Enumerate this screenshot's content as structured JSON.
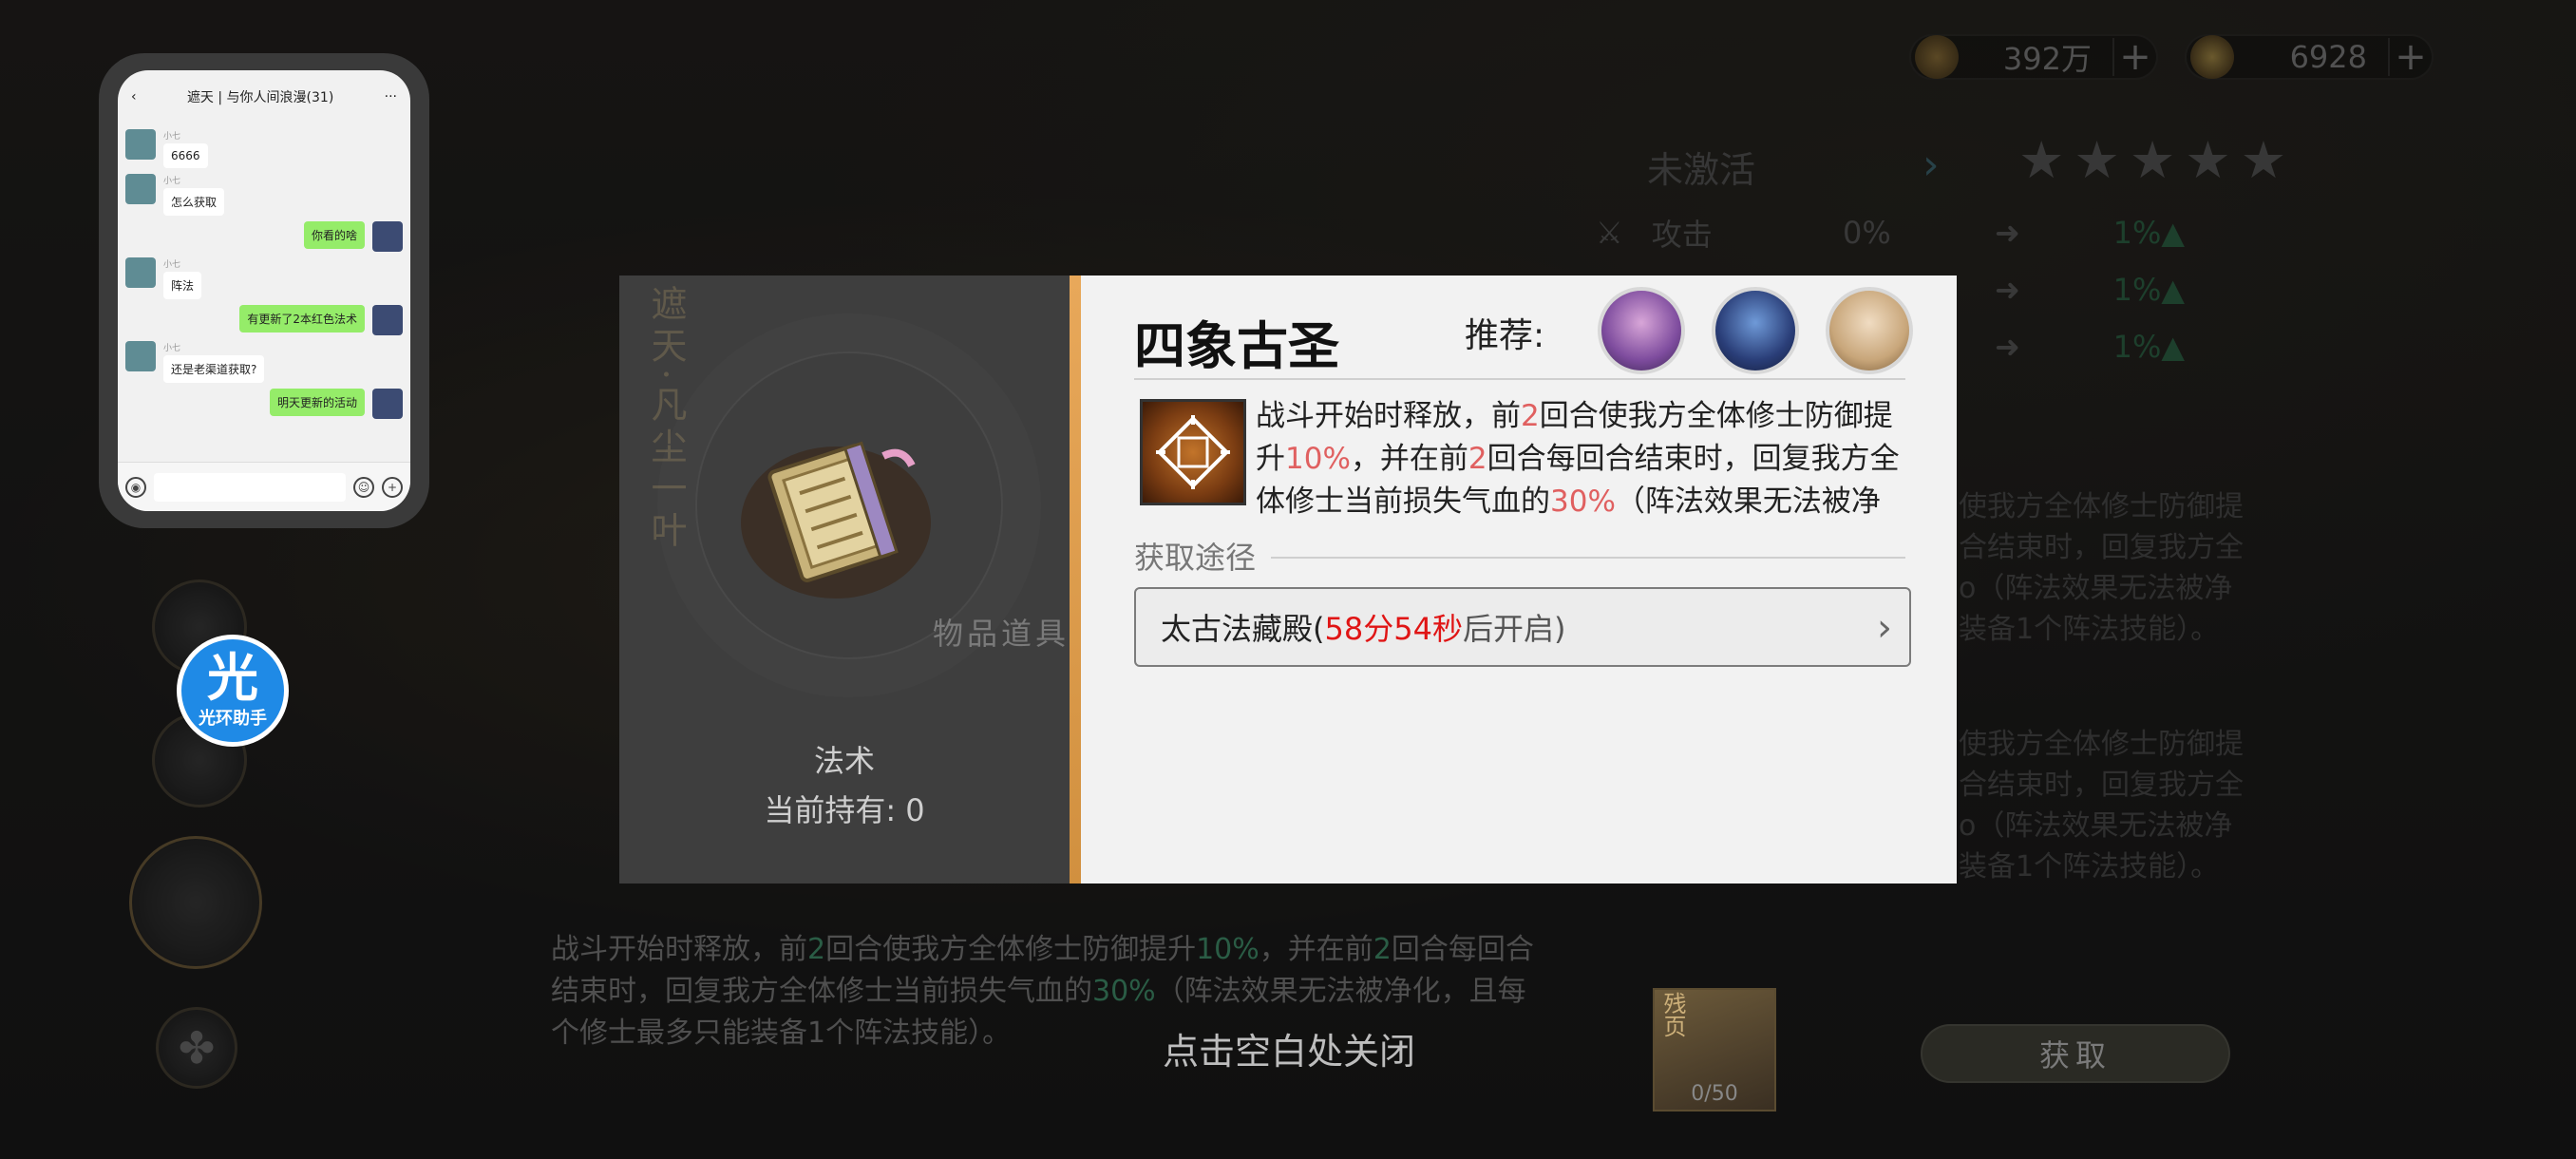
{
  "currency": {
    "coins": "392万",
    "jade": "6928",
    "plus_label": "+"
  },
  "bg_panel": {
    "status": "未激活",
    "stars": [
      "★",
      "★",
      "★",
      "★",
      "★"
    ],
    "attack_label": "攻击",
    "attack_cur": "0%",
    "rows_next": [
      "1%▲",
      "1%▲",
      "1%▲"
    ],
    "desc_a": [
      "使我方全体修士防御提",
      "合结束时，回复我方全",
      "o（阵法效果无法被净",
      "装备1个阵法技能）。"
    ],
    "desc_b": [
      "使我方全体修士防御提",
      "合结束时，回复我方全",
      "o（阵法效果无法被净",
      "装备1个阵法技能）。"
    ]
  },
  "chat": {
    "title": "遮天 | 与你人间浪漫(31)",
    "sender_name": "小七",
    "messages": [
      {
        "side": "left",
        "text": "6666"
      },
      {
        "side": "left",
        "text": "怎么获取"
      },
      {
        "side": "right",
        "text": "你看的啥"
      },
      {
        "side": "left",
        "text": "阵法"
      },
      {
        "side": "right",
        "text": "有更新了2本红色法术"
      },
      {
        "side": "left",
        "text": "还是老渠道获取?"
      },
      {
        "side": "right",
        "text": "明天更新的活动"
      }
    ]
  },
  "assistant": {
    "big": "光",
    "small": "光环助手"
  },
  "dialog": {
    "vertical_text": "遮天·凡尘一叶",
    "item_caption": "物品道具",
    "item_type": "法术",
    "item_own": "当前持有: 0",
    "title": "四象古圣",
    "recommend_label": "推荐:",
    "desc_parts": [
      {
        "t": "战斗开始时释放，前",
        "c": ""
      },
      {
        "t": "2",
        "c": "red"
      },
      {
        "t": "回合使我方全体修士防御提升",
        "c": ""
      },
      {
        "t": "10%",
        "c": "red"
      },
      {
        "t": "，并在前",
        "c": ""
      },
      {
        "t": "2",
        "c": "red"
      },
      {
        "t": "回合每回合结束时，回复我方全体修士当前损失气血的",
        "c": ""
      },
      {
        "t": "30%",
        "c": "red"
      },
      {
        "t": "（阵法效果无法被净化",
        "c": ""
      }
    ],
    "source_label": "获取途径",
    "source_name": "太古法藏殿(",
    "source_timer": "58分54秒",
    "source_after": "后开启)",
    "source_arrow": "›",
    "colors": {
      "accent": "#e8a85a",
      "highlight": "#e06060",
      "timer": "#e01515"
    }
  },
  "bottom": {
    "desc_parts": [
      {
        "t": "战斗开始时释放，前",
        "c": ""
      },
      {
        "t": "2",
        "c": "hl"
      },
      {
        "t": "回合使我方全体修士防御提升",
        "c": ""
      },
      {
        "t": "10%",
        "c": "hl"
      },
      {
        "t": "，并在前",
        "c": ""
      },
      {
        "t": "2",
        "c": "hl"
      },
      {
        "t": "回合每回合结束时，回复我方全体修士当前损失气血的",
        "c": ""
      },
      {
        "t": "30%",
        "c": "hl"
      },
      {
        "t": "（阵法效果无法被净化，且每个修士最多只能装备1个阵法技能）。",
        "c": ""
      }
    ],
    "close_hint": "点击空白处关闭",
    "get_button": "获取",
    "fragment_tag": "残页",
    "fragment_count": "0/50"
  }
}
